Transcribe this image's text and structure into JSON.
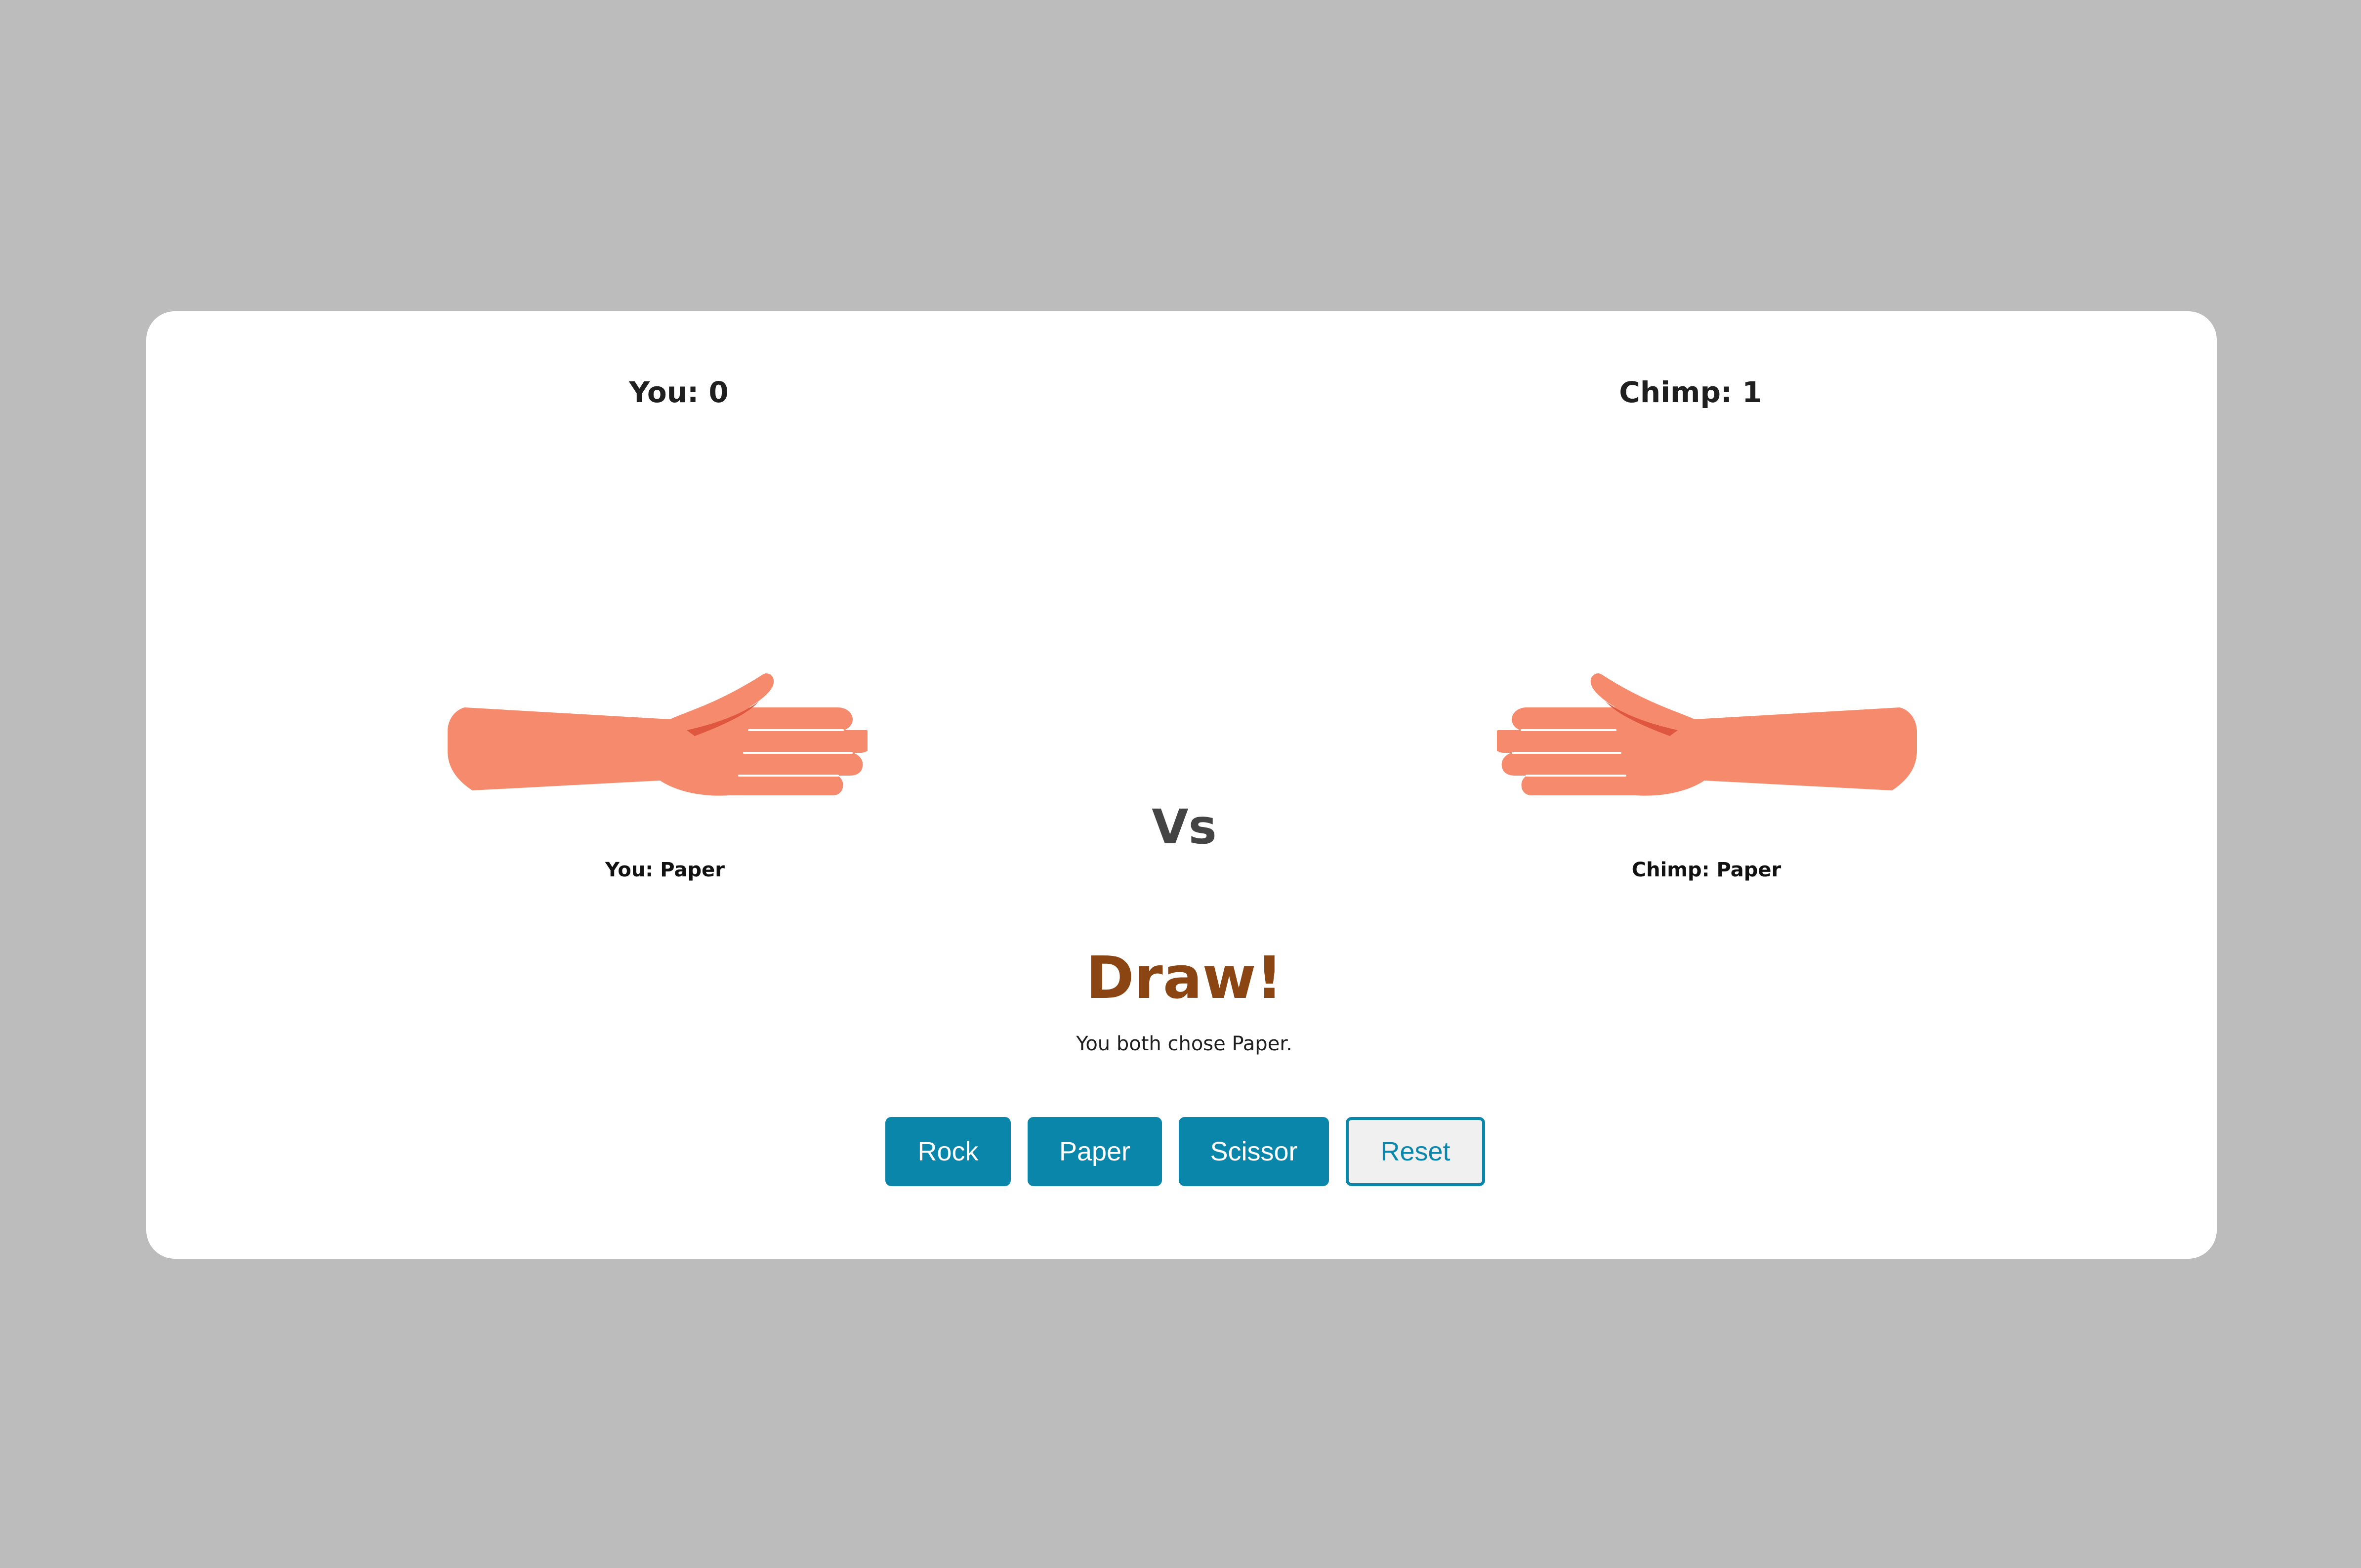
{
  "scores": {
    "you": "You: 0",
    "chimp": "Chimp: 1"
  },
  "choices": {
    "you": "You: Paper",
    "chimp": "Chimp: Paper"
  },
  "vs_label": "Vs",
  "result": {
    "title": "Draw!",
    "detail": "You both chose Paper."
  },
  "buttons": {
    "rock": "Rock",
    "paper": "Paper",
    "scissor": "Scissor",
    "reset": "Reset"
  },
  "hands": {
    "you": "paper-hand-icon",
    "chimp": "paper-hand-icon"
  },
  "colors": {
    "background": "#bcbcbc",
    "card": "#ffffff",
    "skin": "#f58b6c",
    "skin_shadow": "#e0573f",
    "accent": "#0a86aa",
    "result": "#8b4513"
  }
}
